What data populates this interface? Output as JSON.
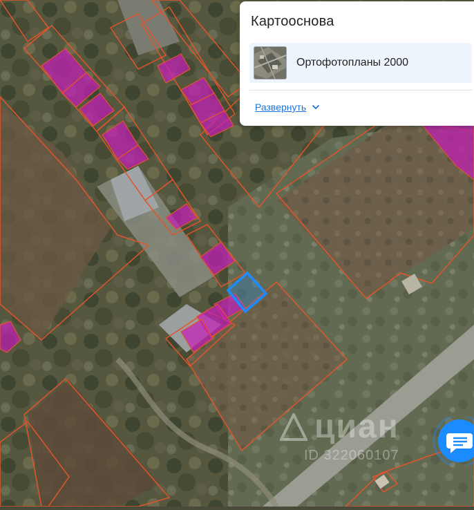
{
  "panel": {
    "title": "Картооснова",
    "layer": {
      "label": "Ортофотопланы 2000",
      "icon": "orthophoto-thumbnail"
    },
    "expand_label": "Развернуть",
    "expand_icon": "chevron-down-icon"
  },
  "watermark": {
    "logo": "циан",
    "id": "ID 322060107"
  },
  "chat": {
    "icon": "chat-icon"
  },
  "colors": {
    "parcel_border": "#e0552c",
    "building_fill": "#c41fb7",
    "selected_parcel": "#1e8bff",
    "link": "#1a73d8",
    "chat_button": "#1a8cff"
  }
}
